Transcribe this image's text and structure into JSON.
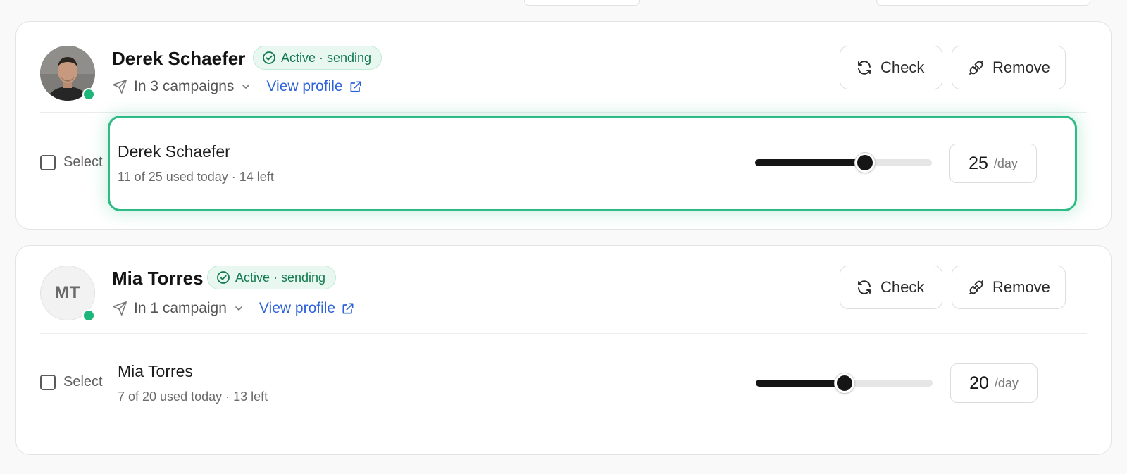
{
  "colors": {
    "accent_green": "#2fbb86",
    "badge_text": "#137a4f",
    "link_blue": "#2d62d8",
    "online": "#1db67a"
  },
  "accounts": [
    {
      "name": "Derek Schaefer",
      "avatar": "photo",
      "status": "Active · sending",
      "campaigns": "In 3 campaigns",
      "view_profile": "View profile",
      "check_label": "Check",
      "remove_label": "Remove",
      "select_label": "Select",
      "sender_name": "Derek Schaefer",
      "usage": "11 of 25 used today · 14 left",
      "daily_limit": "25",
      "unit": "/day",
      "slider_fraction": 0.62,
      "highlighted": true
    },
    {
      "name": "Mia Torres",
      "avatar": "initials",
      "initials": "MT",
      "status": "Active · sending",
      "campaigns": "In 1 campaign",
      "view_profile": "View profile",
      "check_label": "Check",
      "remove_label": "Remove",
      "select_label": "Select",
      "sender_name": "Mia Torres",
      "usage": "7 of 20 used today · 13 left",
      "daily_limit": "20",
      "unit": "/day",
      "slider_fraction": 0.5,
      "highlighted": false
    }
  ]
}
